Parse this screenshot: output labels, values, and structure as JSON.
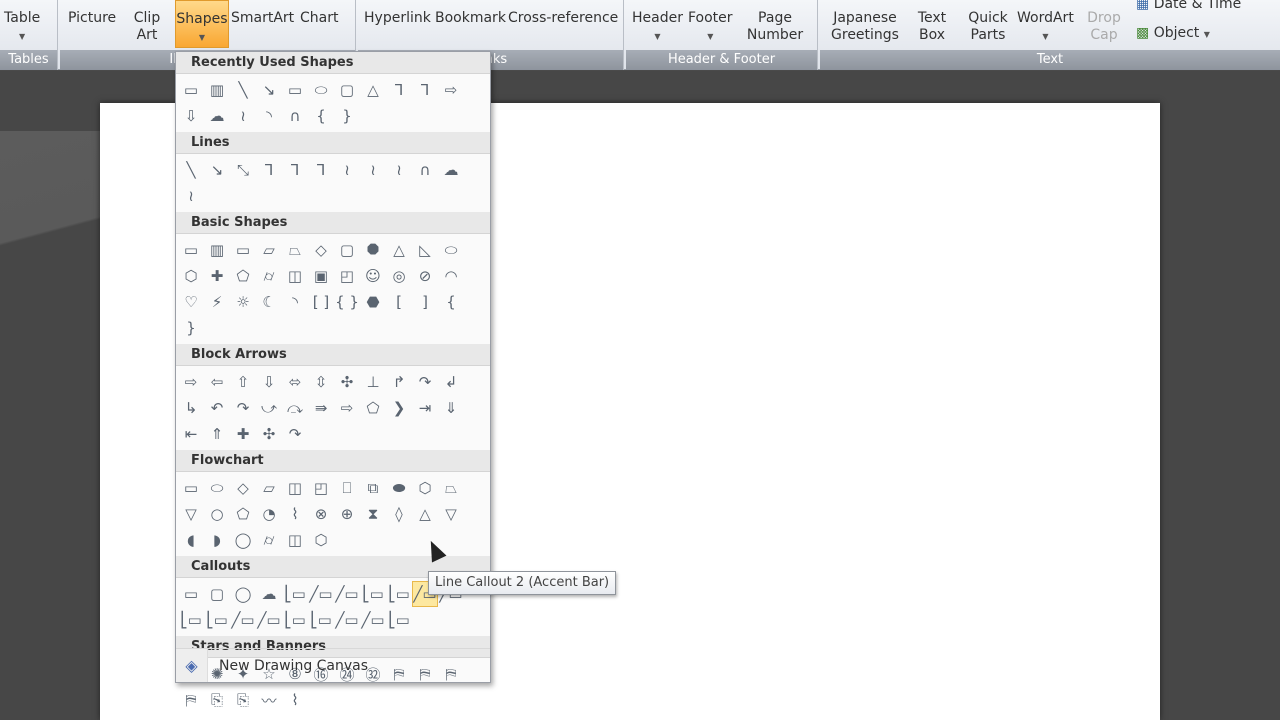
{
  "ribbon": {
    "groups": [
      {
        "label": "Tables",
        "buttons": [
          {
            "label": "Table",
            "dropdown": true
          }
        ]
      },
      {
        "label": "Illustrations",
        "buttons": [
          {
            "label": "Picture"
          },
          {
            "label": "Clip Art"
          },
          {
            "label": "Shapes",
            "dropdown": true,
            "active": true
          },
          {
            "label": "SmartArt"
          },
          {
            "label": "Chart"
          }
        ]
      },
      {
        "label": "Links",
        "buttons": [
          {
            "label": "Hyperlink"
          },
          {
            "label": "Bookmark"
          },
          {
            "label": "Cross-reference"
          }
        ]
      },
      {
        "label": "Header & Footer",
        "buttons": [
          {
            "label": "Header",
            "dropdown": true
          },
          {
            "label": "Footer",
            "dropdown": true
          },
          {
            "label": "Page Number",
            "dropdown": true
          }
        ]
      },
      {
        "label": "Text",
        "buttons": [
          {
            "label": "Japanese Greetings",
            "dropdown": true
          },
          {
            "label": "Text Box",
            "dropdown": true
          },
          {
            "label": "Quick Parts",
            "dropdown": true
          },
          {
            "label": "WordArt",
            "dropdown": true
          },
          {
            "label": "Drop Cap",
            "dropdown": true,
            "disabled": true
          },
          {
            "label": "Date & Time"
          },
          {
            "label": "Object",
            "dropdown": true
          }
        ]
      }
    ]
  },
  "shapes_menu": {
    "sections": [
      {
        "title": "Recently Used Shapes",
        "icons": [
          "▭",
          "▥",
          "╲",
          "↘",
          "▭",
          "⬭",
          "▢",
          "△",
          "⅂",
          "⅂",
          "⇨",
          "⇩",
          "☁",
          "≀",
          "◝",
          "∩",
          "{",
          "}"
        ]
      },
      {
        "title": "Lines",
        "icons": [
          "╲",
          "↘",
          "⤡",
          "⅂",
          "⅂",
          "⅂",
          "≀",
          "≀",
          "≀",
          "∩",
          "☁",
          "≀"
        ]
      },
      {
        "title": "Basic Shapes",
        "icons": [
          "▭",
          "▥",
          "▭",
          "▱",
          "⏢",
          "◇",
          "▢",
          "⯃",
          "△",
          "◺",
          "⬭",
          "⬡",
          "✚",
          "⬠",
          "⌭",
          "◫",
          "▣",
          "◰",
          "☺",
          "◎",
          "⊘",
          "◠",
          "♡",
          "⚡",
          "☼",
          "☾",
          "◝",
          "[ ]",
          "{ }",
          "⬣",
          "[",
          "]",
          "{",
          "}"
        ]
      },
      {
        "title": "Block Arrows",
        "icons": [
          "⇨",
          "⇦",
          "⇧",
          "⇩",
          "⬄",
          "⇳",
          "✣",
          "⊥",
          "↱",
          "↷",
          "↲",
          "↳",
          "↶",
          "↷",
          "⤻",
          "⤼",
          "⇛",
          "⇨",
          "⬠",
          "❯",
          "⇥",
          "⇓",
          "⇤",
          "⇑",
          "✚",
          "✣",
          "↷"
        ]
      },
      {
        "title": "Flowchart",
        "icons": [
          "▭",
          "⬭",
          "◇",
          "▱",
          "◫",
          "◰",
          "⎕",
          "⧉",
          "⬬",
          "⬡",
          "⏢",
          "▽",
          "○",
          "⬠",
          "◔",
          "⌇",
          "⊗",
          "⊕",
          "⧗",
          "◊",
          "△",
          "▽",
          "◖",
          "◗",
          "◯",
          "⌭",
          "◫",
          "⬡"
        ]
      },
      {
        "title": "Callouts",
        "icons": [
          "▭",
          "▢",
          "◯",
          "☁",
          "⎣▭",
          "╱▭",
          "╱▭",
          "⎣▭",
          "⎣▭",
          "╱▭",
          "╱▭",
          "⎣▭",
          "⎣▭",
          "╱▭",
          "╱▭",
          "⎣▭",
          "⎣▭",
          "╱▭",
          "╱▭",
          "⎣▭"
        ],
        "selected_index": 9
      },
      {
        "title": "Stars and Banners",
        "icons": [
          "✹",
          "✺",
          "✦",
          "☆",
          "⑧",
          "⑯",
          "㉔",
          "㉜",
          "⛿",
          "⛿",
          "⛿",
          "⛿",
          "⎘",
          "⎘",
          "〰",
          "⌇"
        ]
      }
    ],
    "footer": {
      "label": "New Drawing Canvas"
    }
  },
  "tooltip": {
    "text": "Line Callout 2 (Accent Bar)"
  }
}
